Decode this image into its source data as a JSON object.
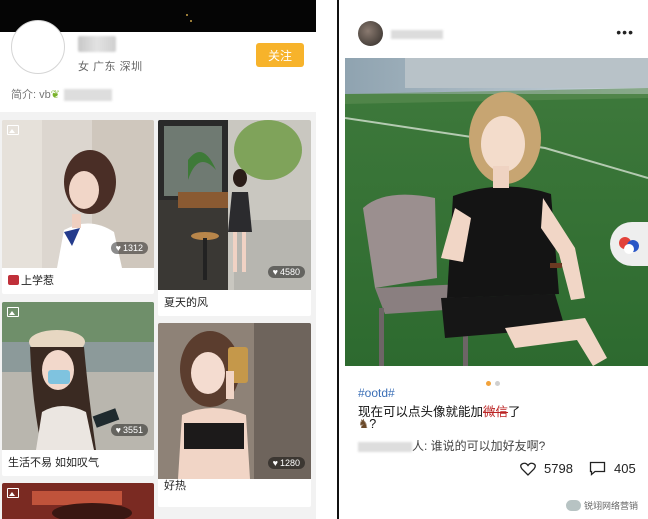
{
  "profile": {
    "location": "女 广东 深圳",
    "follow_label": "关注",
    "bio_prefix": "简介: vb"
  },
  "feed": [
    {
      "caption": "上学惹",
      "likes": "1312"
    },
    {
      "caption": "夏天的风",
      "likes": "4580"
    },
    {
      "caption": "生活不易 如如叹气",
      "likes": "3551"
    },
    {
      "caption": "好热",
      "likes": "1280"
    }
  ],
  "post": {
    "more_label": "•••",
    "hashtag": "#ootd#",
    "text_before": "现在可以点头像就能加",
    "text_struck": "微信",
    "text_after": "了",
    "text_line2": "?",
    "comment_suffix": "人: 谁说的可以加好友啊?",
    "likes": "5798",
    "comments": "405"
  },
  "watermark": {
    "text": "锐翊网络营销"
  },
  "colors": {
    "accent": "#f7b32b",
    "link": "#3b6fb6",
    "indicator": "#f2a23a"
  },
  "icons": [
    "image-icon",
    "heart-icon",
    "comment-icon",
    "more-icon",
    "shopping-bag-icon",
    "horse-emoji-icon",
    "floating-action-icon"
  ]
}
